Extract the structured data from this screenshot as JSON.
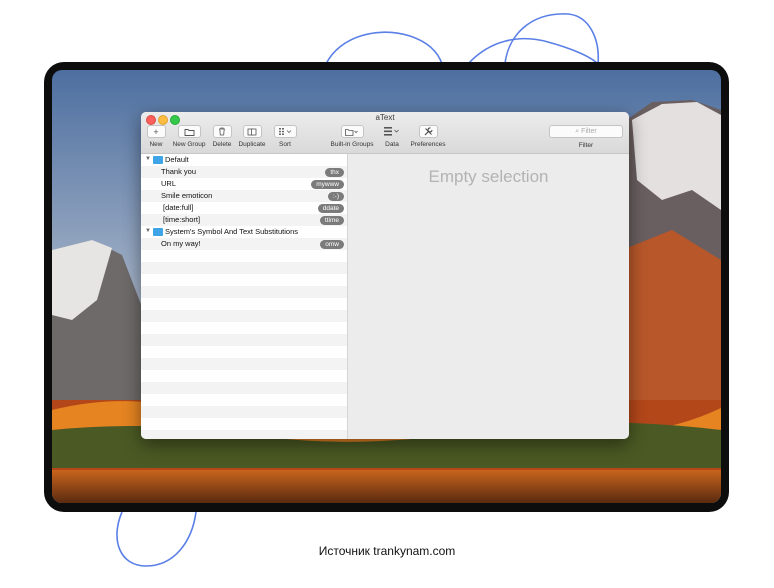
{
  "caption": "Источник trankynam.com",
  "window": {
    "title": "aText",
    "toolbar": [
      {
        "label": "New",
        "icon": "plus-icon"
      },
      {
        "label": "New Group",
        "icon": "new-group-icon"
      },
      {
        "label": "Delete",
        "icon": "trash-icon"
      },
      {
        "label": "Duplicate",
        "icon": "duplicate-icon"
      },
      {
        "label": "Sort",
        "icon": "sort-icon"
      },
      {
        "label": "Built-in Groups",
        "icon": "builtin-groups-icon"
      },
      {
        "label": "Data",
        "icon": "data-icon"
      },
      {
        "label": "Preferences",
        "icon": "wrench-icon"
      }
    ],
    "filter": {
      "placeholder": "Filter",
      "label": "Filter"
    }
  },
  "groups": [
    {
      "name": "Default",
      "items": [
        {
          "label": "Thank you",
          "abbr": "thx"
        },
        {
          "label": "URL",
          "abbr": "mywww"
        },
        {
          "label": "Smile emoticon",
          "abbr": ":-)"
        },
        {
          "label": "[date:full]",
          "abbr": "ddate"
        },
        {
          "label": "[time:short]",
          "abbr": "ttime"
        }
      ]
    },
    {
      "name": "System's Symbol And Text Substitutions",
      "items": [
        {
          "label": "On my way!",
          "abbr": "omw"
        }
      ]
    }
  ],
  "detail": {
    "empty_text": "Empty selection"
  },
  "colors": {
    "accent_outline": "#5a7fe6",
    "folder": "#3fa5e8",
    "badge": "#7b7b7b"
  }
}
